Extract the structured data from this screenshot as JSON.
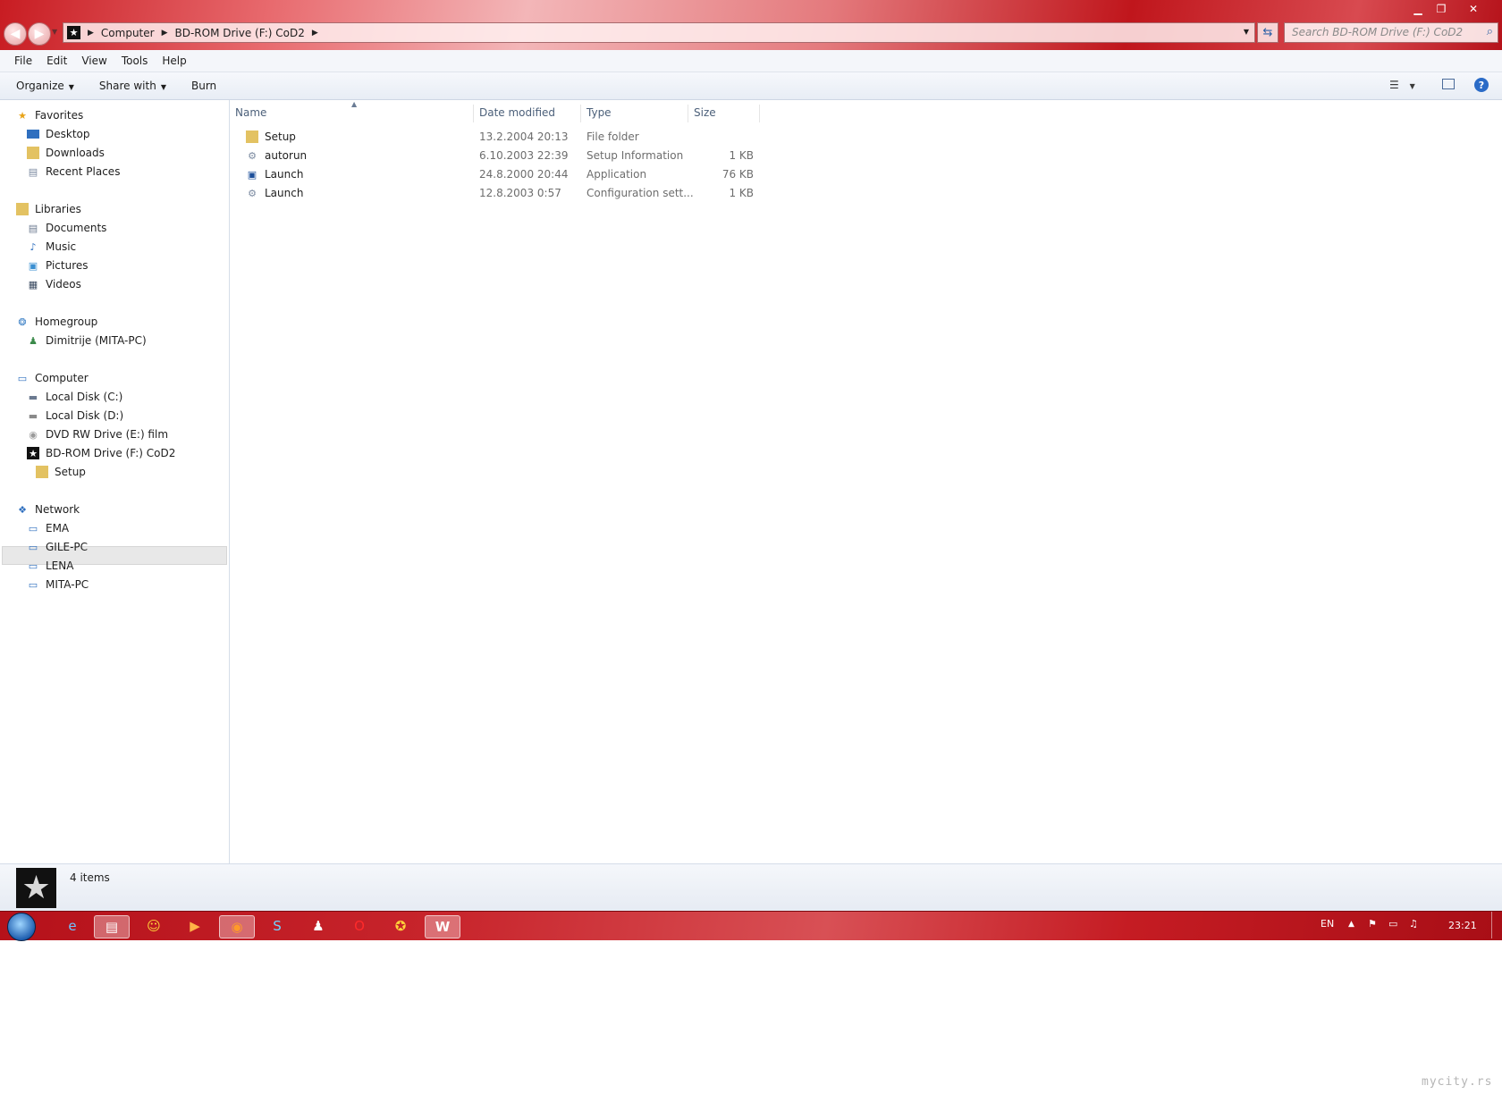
{
  "window": {
    "minimize": "▁",
    "maximize": "❐",
    "close": "✕"
  },
  "address": {
    "crumbs": [
      "Computer",
      "BD-ROM Drive (F:) CoD2"
    ],
    "search_placeholder": "Search BD-ROM Drive (F:) CoD2"
  },
  "menu": [
    "File",
    "Edit",
    "View",
    "Tools",
    "Help"
  ],
  "commands": {
    "organize": "Organize",
    "share_with": "Share with",
    "burn": "Burn"
  },
  "nav": {
    "favorites": {
      "label": "Favorites",
      "items": [
        "Desktop",
        "Downloads",
        "Recent Places"
      ]
    },
    "libraries": {
      "label": "Libraries",
      "items": [
        "Documents",
        "Music",
        "Pictures",
        "Videos"
      ]
    },
    "homegroup": {
      "label": "Homegroup",
      "items": [
        "Dimitrije (MITA-PC)"
      ]
    },
    "computer": {
      "label": "Computer",
      "items": [
        "Local Disk (C:)",
        "Local Disk (D:)",
        "DVD RW Drive (E:) film",
        "BD-ROM Drive (F:) CoD2"
      ],
      "subitem": "Setup"
    },
    "network": {
      "label": "Network",
      "items": [
        "EMA",
        "GILE-PC",
        "LENA",
        "MITA-PC"
      ]
    }
  },
  "columns": {
    "name": "Name",
    "date": "Date modified",
    "type": "Type",
    "size": "Size"
  },
  "files": [
    {
      "name": "Setup",
      "date": "13.2.2004 20:13",
      "type": "File folder",
      "size": "",
      "icon": "folder-icon"
    },
    {
      "name": "autorun",
      "date": "6.10.2003 22:39",
      "type": "Setup Information",
      "size": "1 KB",
      "icon": "setup-info-icon"
    },
    {
      "name": "Launch",
      "date": "24.8.2000 20:44",
      "type": "Application",
      "size": "76 KB",
      "icon": "application-icon"
    },
    {
      "name": "Launch",
      "date": "12.8.2003 0:57",
      "type": "Configuration sett...",
      "size": "1 KB",
      "icon": "config-file-icon"
    }
  ],
  "status": {
    "item_count": "4 items"
  },
  "tray": {
    "language": "EN",
    "time": "23:21"
  },
  "watermark": "mycity.rs",
  "colors": {
    "title_red": "#c81c22",
    "taskbar_red": "#b5111a",
    "selection": "#e8e8e8"
  }
}
